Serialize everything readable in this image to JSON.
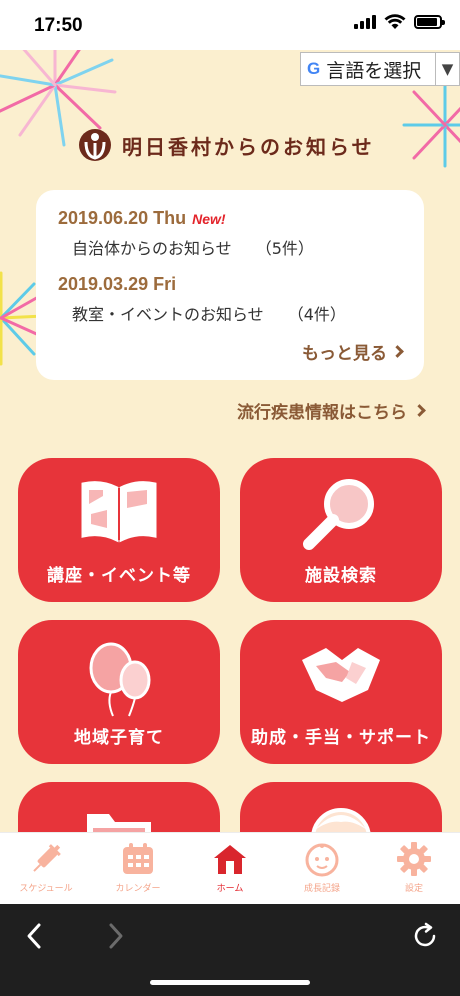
{
  "status_bar": {
    "time": "17:50"
  },
  "language": {
    "label": "言語を選択",
    "logo": "G",
    "arrow": "▼"
  },
  "brand": {
    "title": "明日香村からのお知らせ"
  },
  "news": {
    "items": [
      {
        "date": "2019.06.20 Thu",
        "badge": "New!",
        "text": "自治体からのお知らせ",
        "count": "（5件）"
      },
      {
        "date": "2019.03.29 Fri",
        "badge": "",
        "text": "教室・イベントのお知らせ",
        "count": "（4件）"
      }
    ],
    "more": "もっと見る"
  },
  "disease_link": "流行疾患情報はこちら",
  "tiles": [
    {
      "label": "講座・イベント等",
      "icon": "book-icon"
    },
    {
      "label": "施設検索",
      "icon": "magnifier-icon"
    },
    {
      "label": "地域子育て",
      "icon": "balloons-icon"
    },
    {
      "label": "助成・手当・サポート",
      "icon": "handshake-icon"
    },
    {
      "label": "",
      "icon": "folder-icon"
    },
    {
      "label": "",
      "icon": "face-icon"
    }
  ],
  "tabs": [
    {
      "label": "スケジュール",
      "icon": "syringe-icon"
    },
    {
      "label": "カレンダー",
      "icon": "calendar-icon"
    },
    {
      "label": "ホーム",
      "icon": "house-icon"
    },
    {
      "label": "成長記録",
      "icon": "baby-face-icon"
    },
    {
      "label": "設定",
      "icon": "gear-icon"
    }
  ],
  "colors": {
    "primary": "#e7343a",
    "background": "#fbefcf",
    "brown": "#8a5a36",
    "tab_inactive": "#f4a48a"
  }
}
